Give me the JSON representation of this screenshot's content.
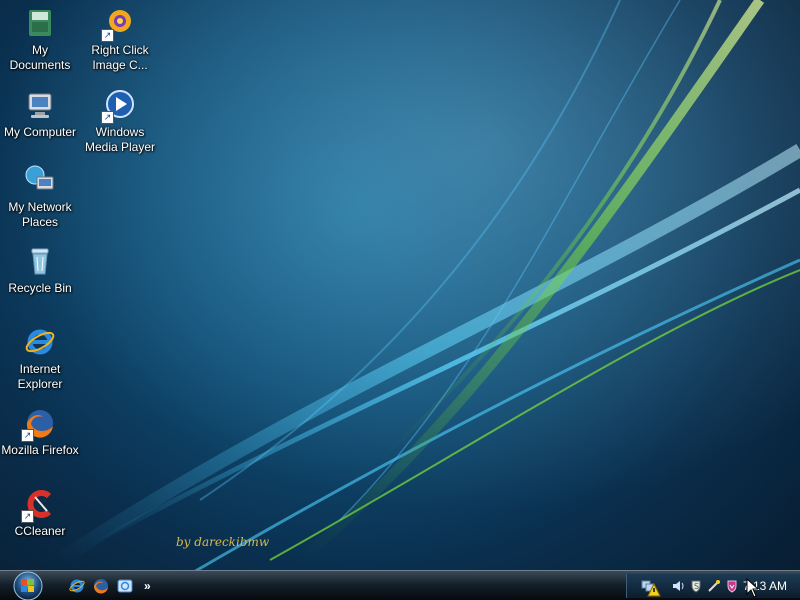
{
  "desktop": {
    "icons": [
      {
        "label": "My Documents",
        "icon": "folder-documents-icon"
      },
      {
        "label": "Right Click Image C...",
        "icon": "gear-sun-icon"
      },
      {
        "label": "My Computer",
        "icon": "computer-icon"
      },
      {
        "label": "Windows Media Player",
        "icon": "media-player-icon"
      },
      {
        "label": "My Network Places",
        "icon": "network-icon"
      },
      {
        "label": "Recycle Bin",
        "icon": "recycle-bin-icon"
      },
      {
        "label": "Internet Explorer",
        "icon": "internet-explorer-icon"
      },
      {
        "label": "Mozilla Firefox",
        "icon": "firefox-icon"
      },
      {
        "label": "CCleaner",
        "icon": "ccleaner-icon"
      }
    ],
    "signature": "by dareckibmw"
  },
  "taskbar": {
    "quick_launch": [
      "internet-explorer-icon",
      "firefox-icon",
      "windows-explorer-icon"
    ],
    "more": "»",
    "tray_icons": [
      "network-icon",
      "warning-icon",
      "speaker-icon",
      "shield-icon",
      "wand-icon",
      "security-shield-icon"
    ],
    "clock": "7:13 AM"
  },
  "colors": {
    "accent_green": "#7fdf3a",
    "accent_blue": "#5ec8ff",
    "signature": "#d8b94a"
  }
}
